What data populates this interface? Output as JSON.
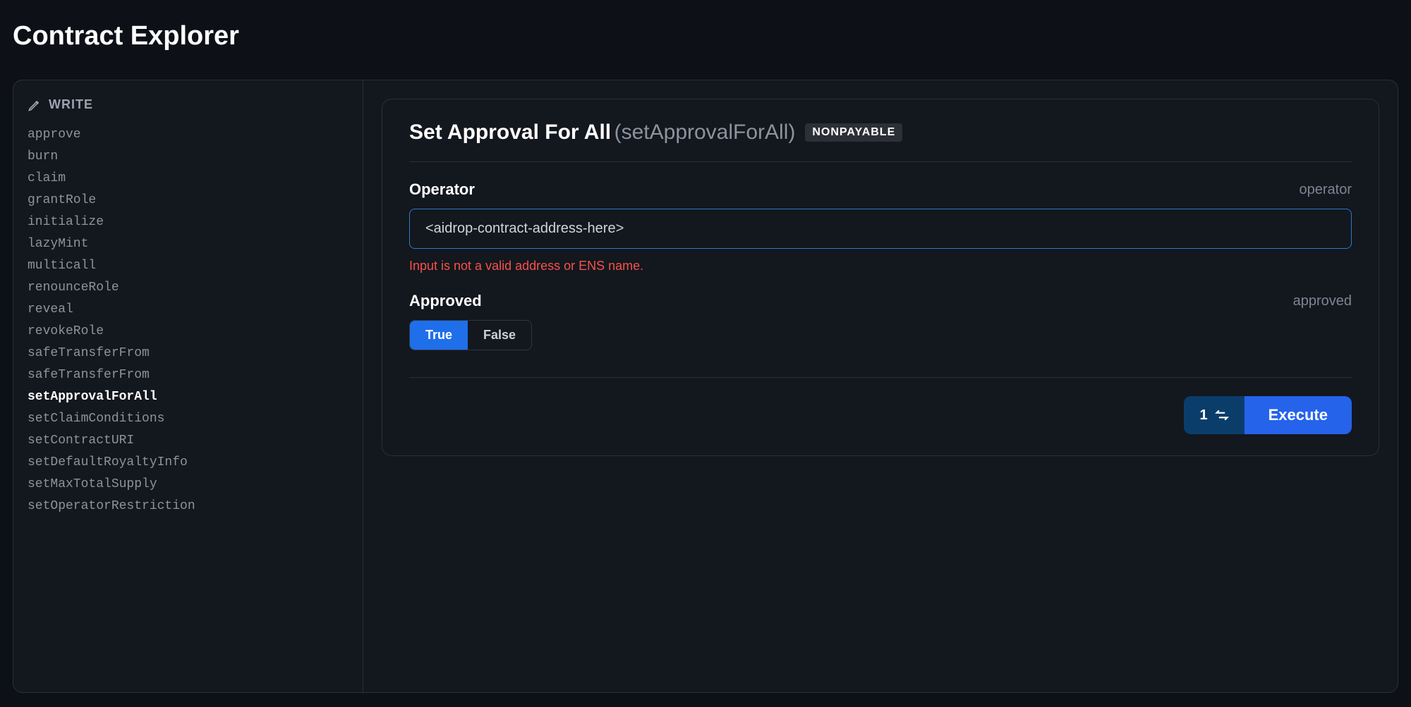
{
  "page": {
    "title": "Contract Explorer"
  },
  "sidebar": {
    "header": "WRITE",
    "items": [
      {
        "label": "approve",
        "active": false
      },
      {
        "label": "burn",
        "active": false
      },
      {
        "label": "claim",
        "active": false
      },
      {
        "label": "grantRole",
        "active": false
      },
      {
        "label": "initialize",
        "active": false
      },
      {
        "label": "lazyMint",
        "active": false
      },
      {
        "label": "multicall",
        "active": false
      },
      {
        "label": "renounceRole",
        "active": false
      },
      {
        "label": "reveal",
        "active": false
      },
      {
        "label": "revokeRole",
        "active": false
      },
      {
        "label": "safeTransferFrom",
        "active": false
      },
      {
        "label": "safeTransferFrom",
        "active": false
      },
      {
        "label": "setApprovalForAll",
        "active": true
      },
      {
        "label": "setClaimConditions",
        "active": false
      },
      {
        "label": "setContractURI",
        "active": false
      },
      {
        "label": "setDefaultRoyaltyInfo",
        "active": false
      },
      {
        "label": "setMaxTotalSupply",
        "active": false
      },
      {
        "label": "setOperatorRestriction",
        "active": false
      }
    ]
  },
  "main": {
    "fnTitle": "Set Approval For All",
    "fnSignature": "(setApprovalForAll)",
    "badge": "NONPAYABLE",
    "operator": {
      "label": "Operator",
      "hint": "operator",
      "value": "<aidrop-contract-address-here>",
      "error": "Input is not a valid address or ENS name."
    },
    "approved": {
      "label": "Approved",
      "hint": "approved",
      "trueLabel": "True",
      "falseLabel": "False"
    },
    "actions": {
      "networkCount": "1",
      "executeLabel": "Execute"
    }
  }
}
